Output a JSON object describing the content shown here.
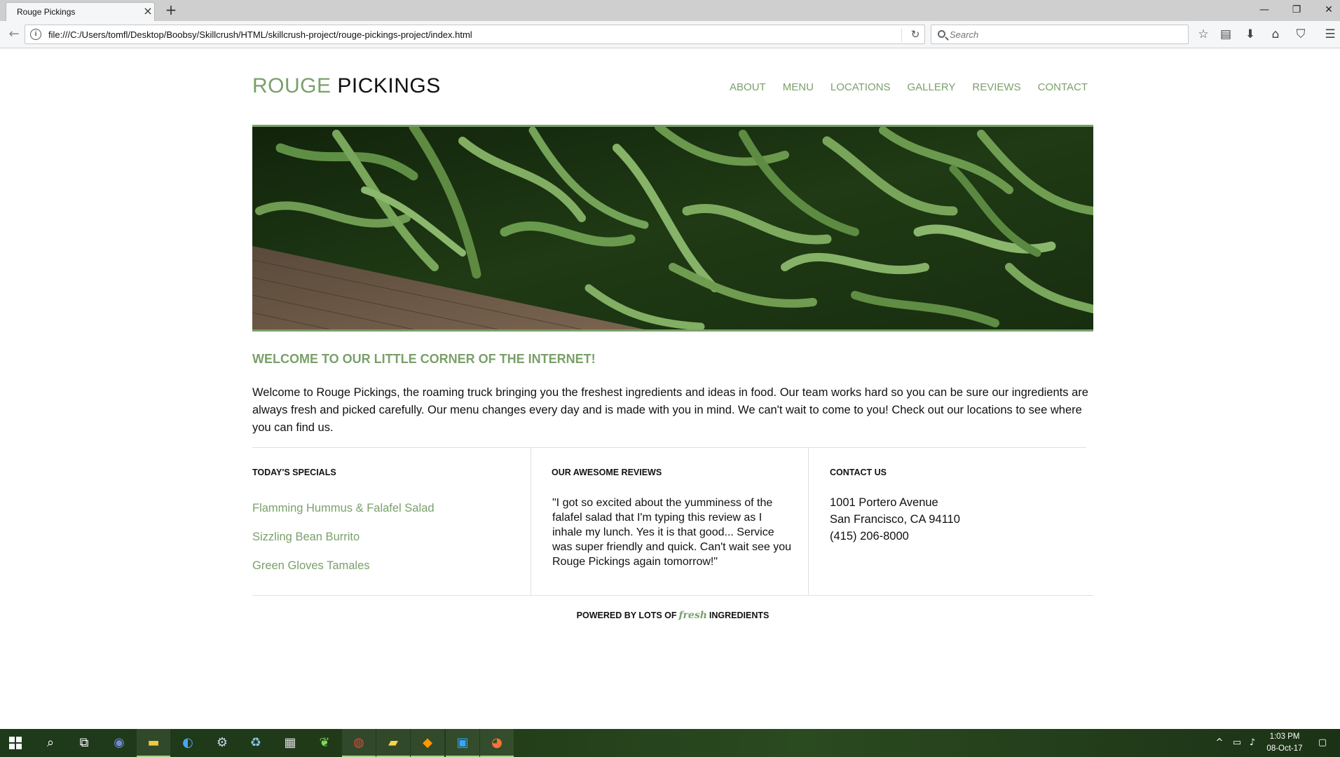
{
  "browser": {
    "tab_title": "Rouge Pickings",
    "url": "file:///C:/Users/tomfl/Desktop/Boobsy/Skillcrush/HTML/skillcrush-project/rouge-pickings-project/index.html",
    "search_placeholder": "Search"
  },
  "site": {
    "logo_first": "ROUGE",
    "logo_second": "PICKINGS",
    "nav": [
      "ABOUT",
      "MENU",
      "LOCATIONS",
      "GALLERY",
      "REVIEWS",
      "CONTACT"
    ],
    "accent_color": "#7aa06a"
  },
  "welcome": {
    "heading": "WELCOME TO OUR LITTLE CORNER OF THE INTERNET!",
    "body": "Welcome to Rouge Pickings, the roaming truck bringing you the freshest ingredients and ideas in food. Our team works hard so you can be sure our ingredients are always fresh and picked carefully. Our menu changes every day and is made with you in mind. We can't wait to come to you! Check out our locations to see where you can find us."
  },
  "specials": {
    "heading": "TODAY'S SPECIALS",
    "items": [
      "Flamming Hummus & Falafel Salad",
      "Sizzling Bean Burrito",
      "Green Gloves Tamales"
    ]
  },
  "reviews": {
    "heading": "OUR AWESOME REVIEWS",
    "text": "\"I got so excited about the yumminess of the falafel salad that I'm typing this review as I inhale my lunch. Yes it is that good... Service was super friendly and quick. Can't wait see you Rouge Pickings again tomorrow!\""
  },
  "contact": {
    "heading": "CONTACT US",
    "lines": [
      "1001 Portero Avenue",
      "San Francisco, CA 94110",
      "(415) 206-8000"
    ]
  },
  "footer": {
    "prefix": "POWERED BY LOTS OF",
    "script_word": "fresh",
    "suffix": "INGREDIENTS"
  },
  "taskbar": {
    "time": "1:03 PM",
    "date": "08-Oct-17"
  }
}
